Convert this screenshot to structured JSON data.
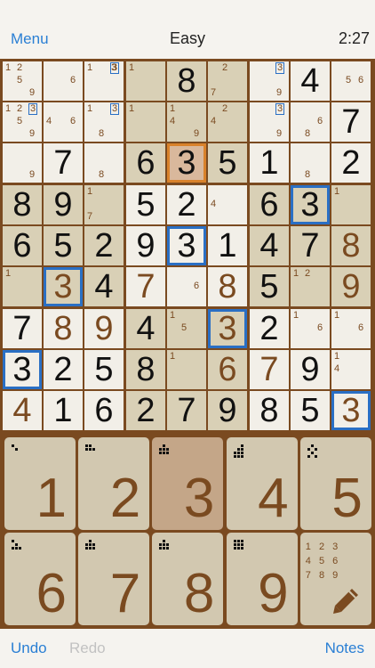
{
  "header": {
    "menu_label": "Menu",
    "difficulty": "Easy",
    "timer": "2:27"
  },
  "board": {
    "rows": [
      [
        {
          "p": [
            "1",
            "2",
            "5",
            "9"
          ]
        },
        {
          "p": [
            "6"
          ]
        },
        {
          "p": [
            "1",
            "3b",
            "3"
          ]
        },
        {
          "p": [
            "1"
          ]
        },
        {
          "v": "8"
        },
        {
          "p": [
            "2",
            "7"
          ]
        },
        {
          "p": [
            "3b",
            "9"
          ]
        },
        {
          "v": "4"
        },
        {
          "p": [
            "5",
            "6"
          ]
        }
      ],
      [
        {
          "p": [
            "1",
            "2",
            "5",
            "9",
            "3b"
          ]
        },
        {
          "p": [
            "4",
            "6"
          ]
        },
        {
          "p": [
            "1",
            "3b",
            "8"
          ]
        },
        {
          "p": [
            "1"
          ]
        },
        {
          "p": [
            "1",
            "4",
            "9"
          ]
        },
        {
          "p": [
            "2",
            "4"
          ]
        },
        {
          "p": [
            "3b",
            "9"
          ]
        },
        {
          "p": [
            "6",
            "8"
          ]
        },
        {
          "v": "7"
        }
      ],
      [
        {
          "p": [
            "9"
          ]
        },
        {
          "v": "7"
        },
        {
          "p": [
            "8"
          ]
        },
        {
          "v": "6"
        },
        {
          "v": "3",
          "cur": true
        },
        {
          "v": "5"
        },
        {
          "v": "1"
        },
        {
          "p": [
            "8"
          ]
        },
        {
          "v": "2"
        }
      ],
      [
        {
          "v": "8"
        },
        {
          "v": "9"
        },
        {
          "p": [
            "1",
            "7"
          ]
        },
        {
          "v": "5"
        },
        {
          "v": "2"
        },
        {
          "p": [
            "4"
          ]
        },
        {
          "v": "6"
        },
        {
          "v": "3",
          "sel": true
        },
        {
          "p": [
            "1"
          ]
        }
      ],
      [
        {
          "v": "6"
        },
        {
          "v": "5"
        },
        {
          "v": "2"
        },
        {
          "v": "9"
        },
        {
          "v": "3",
          "sel": true
        },
        {
          "v": "1"
        },
        {
          "v": "4"
        },
        {
          "v": "7"
        },
        {
          "v": "8",
          "u": true
        }
      ],
      [
        {
          "p": [
            "1"
          ]
        },
        {
          "v": "3",
          "u": true,
          "sel": true
        },
        {
          "v": "4"
        },
        {
          "v": "7",
          "u": true
        },
        {
          "p": [
            "6"
          ]
        },
        {
          "v": "8",
          "u": true
        },
        {
          "v": "5"
        },
        {
          "p": [
            "1",
            "2"
          ]
        },
        {
          "v": "9",
          "u": true
        }
      ],
      [
        {
          "v": "7"
        },
        {
          "v": "8",
          "u": true
        },
        {
          "v": "9",
          "u": true
        },
        {
          "v": "4"
        },
        {
          "p": [
            "1",
            "5"
          ]
        },
        {
          "v": "3",
          "u": true,
          "sel": true
        },
        {
          "v": "2"
        },
        {
          "p": [
            "1",
            "6"
          ]
        },
        {
          "p": [
            "1",
            "6"
          ]
        }
      ],
      [
        {
          "v": "3",
          "sel": true
        },
        {
          "v": "2"
        },
        {
          "v": "5"
        },
        {
          "v": "8"
        },
        {
          "p": [
            "1"
          ]
        },
        {
          "v": "6",
          "u": true
        },
        {
          "v": "7",
          "u": true
        },
        {
          "v": "9"
        },
        {
          "p": [
            "1",
            "4"
          ]
        }
      ],
      [
        {
          "v": "4",
          "u": true
        },
        {
          "v": "1"
        },
        {
          "v": "6"
        },
        {
          "v": "2"
        },
        {
          "v": "7"
        },
        {
          "v": "9"
        },
        {
          "v": "8"
        },
        {
          "v": "5"
        },
        {
          "v": "3",
          "u": true,
          "sel": true
        }
      ]
    ]
  },
  "keypad": {
    "keys": [
      {
        "label": "1",
        "active": false
      },
      {
        "label": "2",
        "active": false
      },
      {
        "label": "3",
        "active": true
      },
      {
        "label": "4",
        "active": false
      },
      {
        "label": "5",
        "active": false
      },
      {
        "label": "6",
        "active": false
      },
      {
        "label": "7",
        "active": false
      },
      {
        "label": "8",
        "active": false
      },
      {
        "label": "9",
        "active": false
      }
    ],
    "notes_key": {
      "digits": [
        "1 2 3",
        "4 5 6",
        "7 8 9"
      ],
      "icon": "pencil-icon"
    }
  },
  "footer": {
    "undo_label": "Undo",
    "redo_label": "Redo",
    "notes_label": "Notes"
  },
  "colors": {
    "accent": "#2a7fd4",
    "frame": "#7a4a20",
    "selection": "#2a6fc4",
    "current": "#d9822b"
  }
}
